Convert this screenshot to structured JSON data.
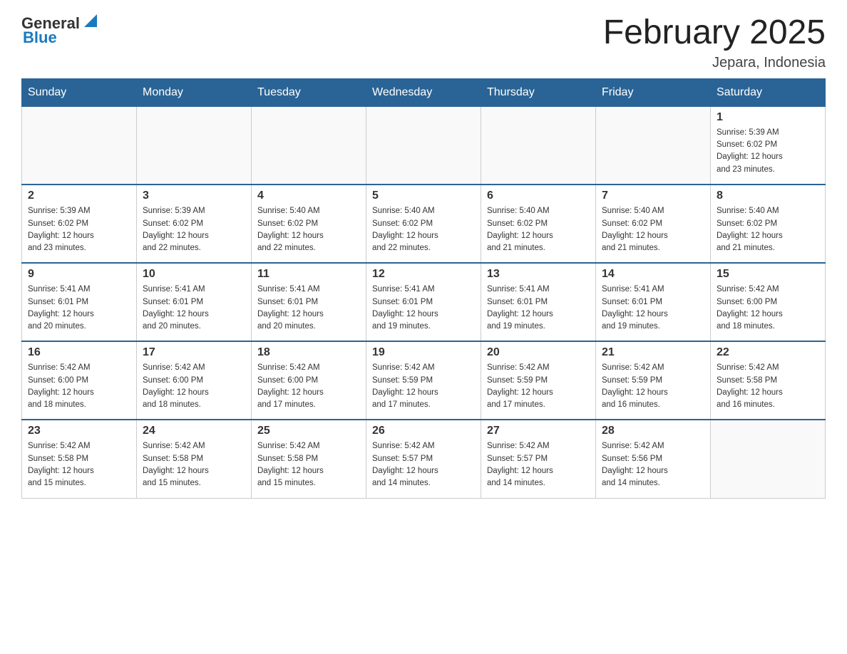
{
  "header": {
    "logo": {
      "general": "General",
      "blue": "Blue"
    },
    "title": "February 2025",
    "location": "Jepara, Indonesia"
  },
  "weekdays": [
    "Sunday",
    "Monday",
    "Tuesday",
    "Wednesday",
    "Thursday",
    "Friday",
    "Saturday"
  ],
  "weeks": [
    [
      {
        "day": "",
        "info": ""
      },
      {
        "day": "",
        "info": ""
      },
      {
        "day": "",
        "info": ""
      },
      {
        "day": "",
        "info": ""
      },
      {
        "day": "",
        "info": ""
      },
      {
        "day": "",
        "info": ""
      },
      {
        "day": "1",
        "info": "Sunrise: 5:39 AM\nSunset: 6:02 PM\nDaylight: 12 hours\nand 23 minutes."
      }
    ],
    [
      {
        "day": "2",
        "info": "Sunrise: 5:39 AM\nSunset: 6:02 PM\nDaylight: 12 hours\nand 23 minutes."
      },
      {
        "day": "3",
        "info": "Sunrise: 5:39 AM\nSunset: 6:02 PM\nDaylight: 12 hours\nand 22 minutes."
      },
      {
        "day": "4",
        "info": "Sunrise: 5:40 AM\nSunset: 6:02 PM\nDaylight: 12 hours\nand 22 minutes."
      },
      {
        "day": "5",
        "info": "Sunrise: 5:40 AM\nSunset: 6:02 PM\nDaylight: 12 hours\nand 22 minutes."
      },
      {
        "day": "6",
        "info": "Sunrise: 5:40 AM\nSunset: 6:02 PM\nDaylight: 12 hours\nand 21 minutes."
      },
      {
        "day": "7",
        "info": "Sunrise: 5:40 AM\nSunset: 6:02 PM\nDaylight: 12 hours\nand 21 minutes."
      },
      {
        "day": "8",
        "info": "Sunrise: 5:40 AM\nSunset: 6:02 PM\nDaylight: 12 hours\nand 21 minutes."
      }
    ],
    [
      {
        "day": "9",
        "info": "Sunrise: 5:41 AM\nSunset: 6:01 PM\nDaylight: 12 hours\nand 20 minutes."
      },
      {
        "day": "10",
        "info": "Sunrise: 5:41 AM\nSunset: 6:01 PM\nDaylight: 12 hours\nand 20 minutes."
      },
      {
        "day": "11",
        "info": "Sunrise: 5:41 AM\nSunset: 6:01 PM\nDaylight: 12 hours\nand 20 minutes."
      },
      {
        "day": "12",
        "info": "Sunrise: 5:41 AM\nSunset: 6:01 PM\nDaylight: 12 hours\nand 19 minutes."
      },
      {
        "day": "13",
        "info": "Sunrise: 5:41 AM\nSunset: 6:01 PM\nDaylight: 12 hours\nand 19 minutes."
      },
      {
        "day": "14",
        "info": "Sunrise: 5:41 AM\nSunset: 6:01 PM\nDaylight: 12 hours\nand 19 minutes."
      },
      {
        "day": "15",
        "info": "Sunrise: 5:42 AM\nSunset: 6:00 PM\nDaylight: 12 hours\nand 18 minutes."
      }
    ],
    [
      {
        "day": "16",
        "info": "Sunrise: 5:42 AM\nSunset: 6:00 PM\nDaylight: 12 hours\nand 18 minutes."
      },
      {
        "day": "17",
        "info": "Sunrise: 5:42 AM\nSunset: 6:00 PM\nDaylight: 12 hours\nand 18 minutes."
      },
      {
        "day": "18",
        "info": "Sunrise: 5:42 AM\nSunset: 6:00 PM\nDaylight: 12 hours\nand 17 minutes."
      },
      {
        "day": "19",
        "info": "Sunrise: 5:42 AM\nSunset: 5:59 PM\nDaylight: 12 hours\nand 17 minutes."
      },
      {
        "day": "20",
        "info": "Sunrise: 5:42 AM\nSunset: 5:59 PM\nDaylight: 12 hours\nand 17 minutes."
      },
      {
        "day": "21",
        "info": "Sunrise: 5:42 AM\nSunset: 5:59 PM\nDaylight: 12 hours\nand 16 minutes."
      },
      {
        "day": "22",
        "info": "Sunrise: 5:42 AM\nSunset: 5:58 PM\nDaylight: 12 hours\nand 16 minutes."
      }
    ],
    [
      {
        "day": "23",
        "info": "Sunrise: 5:42 AM\nSunset: 5:58 PM\nDaylight: 12 hours\nand 15 minutes."
      },
      {
        "day": "24",
        "info": "Sunrise: 5:42 AM\nSunset: 5:58 PM\nDaylight: 12 hours\nand 15 minutes."
      },
      {
        "day": "25",
        "info": "Sunrise: 5:42 AM\nSunset: 5:58 PM\nDaylight: 12 hours\nand 15 minutes."
      },
      {
        "day": "26",
        "info": "Sunrise: 5:42 AM\nSunset: 5:57 PM\nDaylight: 12 hours\nand 14 minutes."
      },
      {
        "day": "27",
        "info": "Sunrise: 5:42 AM\nSunset: 5:57 PM\nDaylight: 12 hours\nand 14 minutes."
      },
      {
        "day": "28",
        "info": "Sunrise: 5:42 AM\nSunset: 5:56 PM\nDaylight: 12 hours\nand 14 minutes."
      },
      {
        "day": "",
        "info": ""
      }
    ]
  ]
}
